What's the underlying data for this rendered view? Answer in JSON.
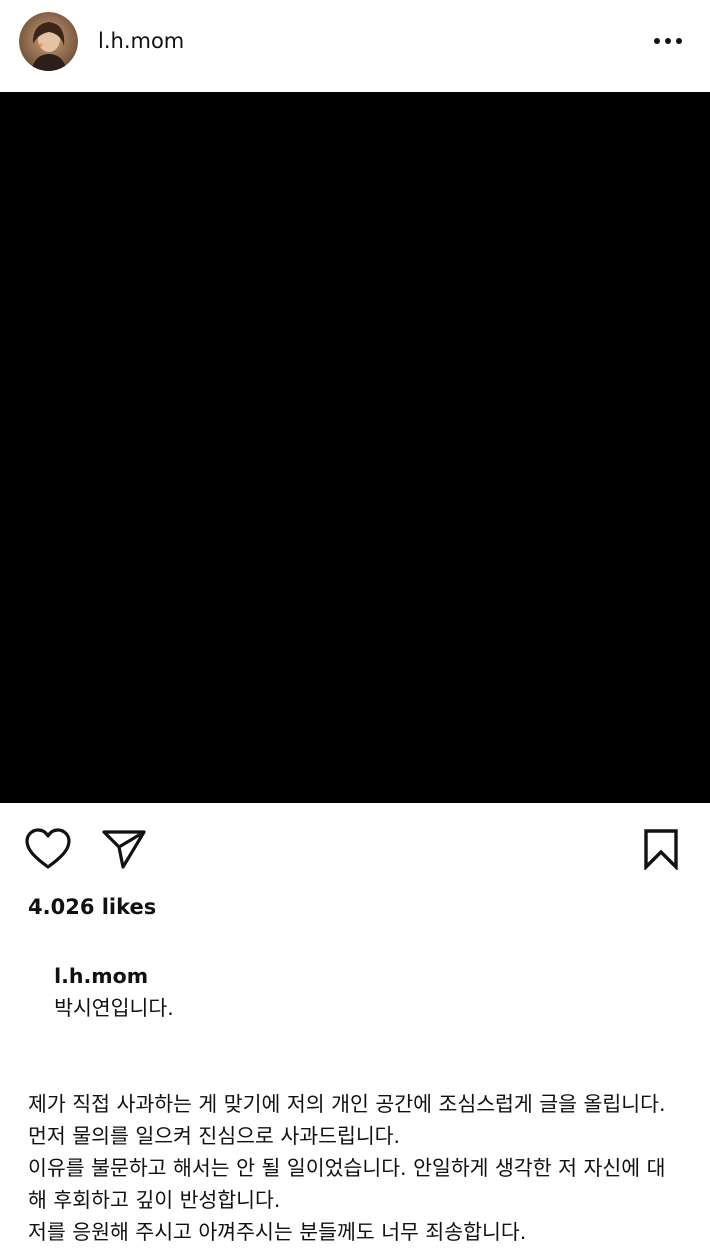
{
  "post": {
    "username": "l.h.mom",
    "more_icon": "more-horizontal-icon"
  },
  "media": {
    "background": "#000000"
  },
  "actions": {
    "like_icon": "heart-icon",
    "share_icon": "send-icon",
    "save_icon": "bookmark-icon"
  },
  "likes": {
    "text": "4.026 likes"
  },
  "caption": {
    "username": "l.h.mom",
    "first_text": "박시연입니다.",
    "lines": [
      "제가 직접 사과하는 게 맞기에 저의 개인 공간에 조심스럽게 글을 올립니다.",
      "먼저 물의를 일으켜 진심으로 사과드립니다.",
      "이유를 불문하고 해서는 안 될 일이었습니다. 안일하게 생각한 저 자신에 대해 후회하고 깊이 반성합니다.",
      "저를 응원해 주시고 아껴주시는 분들께도 너무 죄송합니다."
    ]
  }
}
